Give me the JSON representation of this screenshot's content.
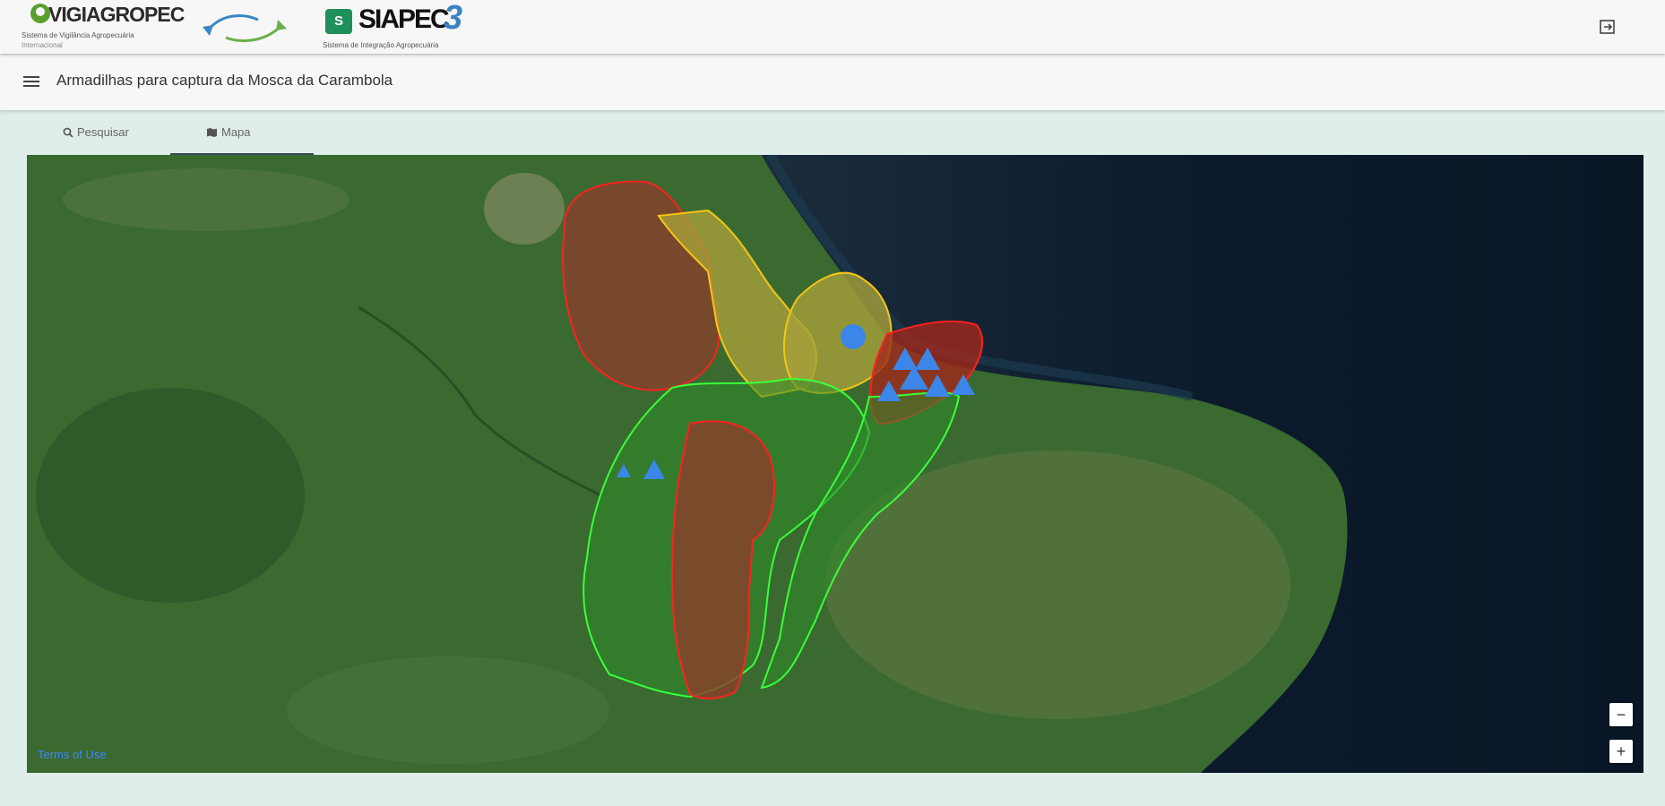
{
  "header": {
    "logo_vigiagropec": {
      "name": "VIGIAGROPEC",
      "subtitle_1": "Sistema de Vigilância Agropecuária",
      "subtitle_2": "Internacional"
    },
    "logo_siapec": {
      "name": "SIAPEC",
      "version": "3",
      "subtitle": "Sistema de Integração Agropecuária"
    },
    "icons": {
      "sync": "arrows-sync-icon",
      "logout": "logout-icon"
    }
  },
  "titlebar": {
    "title": "Armadilhas para captura da Mosca da Carambola",
    "menu_icon": "menu-icon"
  },
  "tabs": [
    {
      "label": "Pesquisar",
      "icon": "search-icon",
      "active": false
    },
    {
      "label": "Mapa",
      "icon": "map-icon",
      "active": true
    }
  ],
  "map": {
    "terms_link": "Terms of Use",
    "zoom_out": "−",
    "zoom_in": "+",
    "region_colors": {
      "red": "#e8261b",
      "yellow": "#f2c21a",
      "green": "#2ee32a"
    },
    "marker_color": "#3b86e8"
  }
}
